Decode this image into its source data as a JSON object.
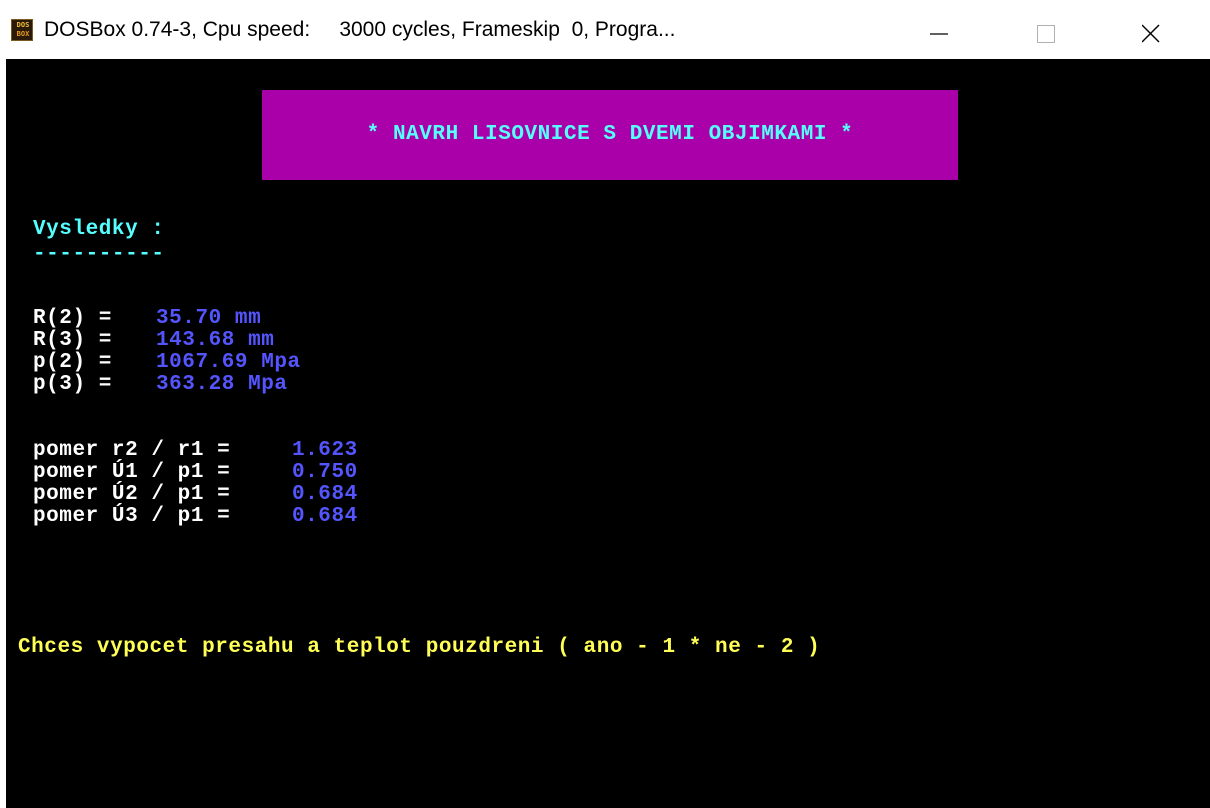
{
  "window": {
    "icon_line1": "DOS",
    "icon_line2": "BOX",
    "title": "DOSBox 0.74-3, Cpu speed:     3000 cycles, Frameskip  0, Progra..."
  },
  "screen": {
    "banner": "* NAVRH LISOVNICE S DVEMI OBJIMKAMI *",
    "results_heading": "Vysledky :",
    "results_underline": "----------",
    "radii": [
      {
        "label": "R(2) =",
        "value": "35.70 mm"
      },
      {
        "label": "R(3) =",
        "value": "143.68 mm"
      },
      {
        "label": "p(2) =",
        "value": "1067.69 Mpa"
      },
      {
        "label": "p(3) =",
        "value": "363.28 Mpa"
      }
    ],
    "ratios": [
      {
        "label": "pomer r2 / r1 =",
        "value": "1.623"
      },
      {
        "label": "pomer Ú1 / p1 =",
        "value": "0.750"
      },
      {
        "label": "pomer Ú2 / p1 =",
        "value": "0.684"
      },
      {
        "label": "pomer Ú3 / p1 =",
        "value": "0.684"
      }
    ],
    "prompt": "Chces vypocet presahu a teplot pouzdreni ( ano - 1 * ne - 2 )"
  },
  "colors": {
    "banner_bg": "#aa00aa",
    "cyan": "#55ffff",
    "white": "#ffffff",
    "blue": "#5555ff",
    "yellow": "#ffff55",
    "screen_bg": "#000000"
  }
}
